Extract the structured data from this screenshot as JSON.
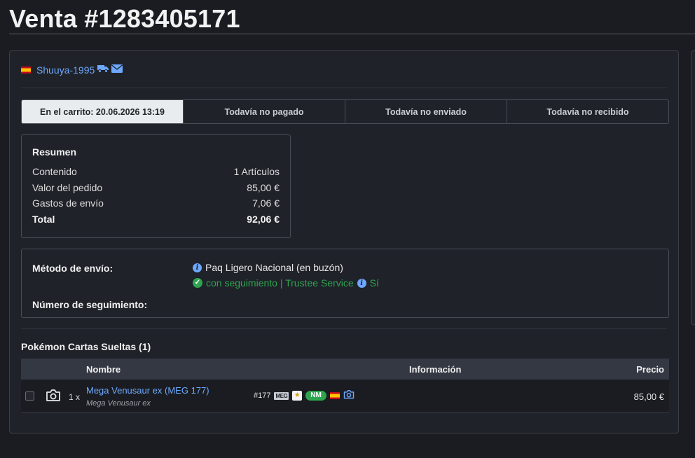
{
  "page": {
    "title": "Venta #1283405171"
  },
  "buyer": {
    "username": "Shuuya-1995",
    "country_flag": "es-flag",
    "icons": [
      "truck-icon",
      "envelope-icon"
    ]
  },
  "status": [
    "En el carrito: 20.06.2026  13:19",
    "Todavía no pagado",
    "Todavía no enviado",
    "Todavía no recibido"
  ],
  "summary": {
    "heading": "Resumen",
    "rows": [
      {
        "label": "Contenido",
        "value": "1 Artículos"
      },
      {
        "label": "Valor del pedido",
        "value": "85,00 €"
      },
      {
        "label": "Gastos de envío",
        "value": "7,06 €"
      },
      {
        "label": "Total",
        "value": "92,06 €"
      }
    ]
  },
  "shipping": {
    "method_label": "Método de envío:",
    "method_value": "Paq Ligero Nacional (en buzón)",
    "tracking_text": "con seguimiento | Trustee Service",
    "trustee_value": "Sí",
    "tracking_number_label": "Número de seguimiento:"
  },
  "section": {
    "title": "Pokémon Cartas Sueltas (1)"
  },
  "table": {
    "headers": {
      "name": "Nombre",
      "info": "Información",
      "price": "Precio"
    },
    "rows": [
      {
        "qty": "1 x",
        "name": "Mega Venusaur ex (MEG 177)",
        "subname": "Mega Venusaur ex",
        "number": "#177",
        "set_code": "MEG",
        "condition": "NM",
        "price": "85,00 €"
      }
    ]
  },
  "colors": {
    "link": "#6ea8fe",
    "green": "#2ea44f",
    "background": "#1a1c22"
  }
}
